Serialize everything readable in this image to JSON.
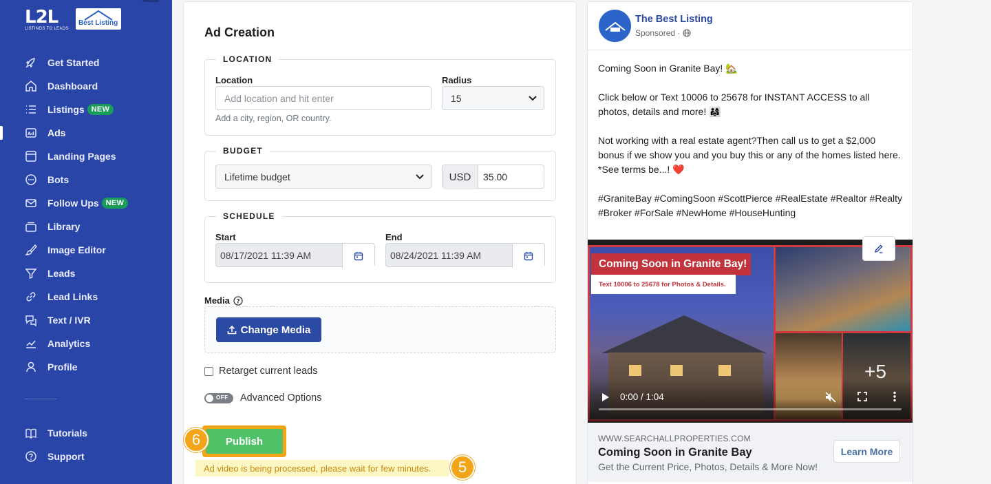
{
  "brand": {
    "l2l_logo": "L2L",
    "l2l_tagline": "LISTINGS TO LEADS",
    "partner_logo": "Best Listing"
  },
  "sidebar": {
    "items": [
      {
        "label": "Get Started",
        "icon": "rocket-icon"
      },
      {
        "label": "Dashboard",
        "icon": "home-icon"
      },
      {
        "label": "Listings",
        "icon": "list-icon",
        "badge": "NEW"
      },
      {
        "label": "Ads",
        "icon": "ad-icon",
        "active": true
      },
      {
        "label": "Landing Pages",
        "icon": "page-icon"
      },
      {
        "label": "Bots",
        "icon": "chat-icon"
      },
      {
        "label": "Follow Ups",
        "icon": "mail-icon",
        "badge": "NEW"
      },
      {
        "label": "Library",
        "icon": "library-icon"
      },
      {
        "label": "Image Editor",
        "icon": "brush-icon"
      },
      {
        "label": "Leads",
        "icon": "filter-icon"
      },
      {
        "label": "Lead Links",
        "icon": "link-icon"
      },
      {
        "label": "Text / IVR",
        "icon": "message-icon"
      },
      {
        "label": "Analytics",
        "icon": "chart-icon"
      },
      {
        "label": "Profile",
        "icon": "user-icon"
      }
    ],
    "bottom_items": [
      {
        "label": "Tutorials",
        "icon": "book-icon"
      },
      {
        "label": "Support",
        "icon": "question-icon"
      }
    ]
  },
  "form": {
    "title": "Ad Creation",
    "location": {
      "legend": "LOCATION",
      "location_label": "Location",
      "location_placeholder": "Add location and hit enter",
      "location_help": "Add a city, region, OR country.",
      "radius_label": "Radius",
      "radius_value": "15"
    },
    "budget": {
      "legend": "BUDGET",
      "type_value": "Lifetime budget",
      "currency": "USD",
      "amount": "35.00"
    },
    "schedule": {
      "legend": "SCHEDULE",
      "start_label": "Start",
      "start_value": "08/17/2021 11:39 AM",
      "end_label": "End",
      "end_value": "08/24/2021 11:39 AM"
    },
    "media": {
      "label": "Media",
      "change_button": "Change Media"
    },
    "retarget_label": "Retarget current leads",
    "advanced": {
      "toggle_state": "OFF",
      "label": "Advanced Options"
    },
    "publish_label": "Publish",
    "processing_message": "Ad video is being processed, please wait for few minutes.",
    "step_markers": [
      "6",
      "5"
    ]
  },
  "preview": {
    "page_name": "The Best Listing",
    "sponsored": "Sponsored ·",
    "body_lines": [
      "Coming Soon in Granite Bay! 🏡",
      "",
      "Click below or Text 10006 to 25678 for INSTANT ACCESS to all",
      "photos, details and more! 👨‍👩‍👧",
      "",
      "Not working with a real estate agent?Then call us to get a $2,000",
      "bonus if we show you and you buy this or any of the homes listed here.",
      "*See terms be...! ❤️",
      "",
      "#GraniteBay #ComingSoon #ScottPierce #RealEstate #Realtor #Realty",
      "#Broker #ForSale #NewHome #HouseHunting"
    ],
    "media_banner": "Coming Soon in Granite Bay!",
    "media_subbanner": "Text 10006 to 25678 for Photos & Details.",
    "media_more": "+5",
    "video_time": "0:00 / 1:04",
    "link_url": "WWW.SEARCHALLPROPERTIES.COM",
    "headline": "Coming Soon in Granite Bay",
    "description": "Get the Current Price, Photos, Details & More Now!",
    "cta": "Learn More"
  }
}
